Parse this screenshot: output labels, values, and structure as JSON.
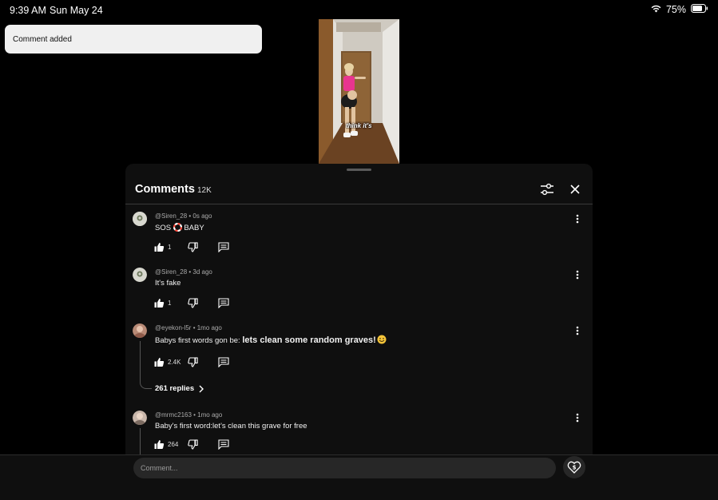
{
  "status_bar": {
    "time": "9:39 AM",
    "date": "Sun May 24",
    "battery": "75%"
  },
  "toast": {
    "text": "Comment added"
  },
  "video": {
    "caption": "think it's"
  },
  "comments_panel": {
    "title": "Comments",
    "count": "12K",
    "comments": [
      {
        "author": "@Siren_28",
        "age": "0s ago",
        "text_pre": "SOS ",
        "text_post": " BABY",
        "likes": "1"
      },
      {
        "author": "@Siren_28",
        "age": "3d ago",
        "text": "It's fake",
        "likes": "1"
      },
      {
        "author": "@eyekon-l5r",
        "age": "1mo ago",
        "text_pre": "Babys first words gon be: ",
        "text_bold": "lets clean some random graves!",
        "likes": "2.4K",
        "replies": "261 replies"
      },
      {
        "author": "@mrmc2163",
        "age": "1mo ago",
        "text": "Baby's first word:let's clean this grave for free",
        "likes": "264"
      }
    ]
  },
  "composer": {
    "placeholder": "Comment..."
  },
  "colors": {
    "background": "#000000",
    "panel": "#0f0f0f",
    "toast": "#f0f0f0",
    "shirt": "#e8358f"
  }
}
